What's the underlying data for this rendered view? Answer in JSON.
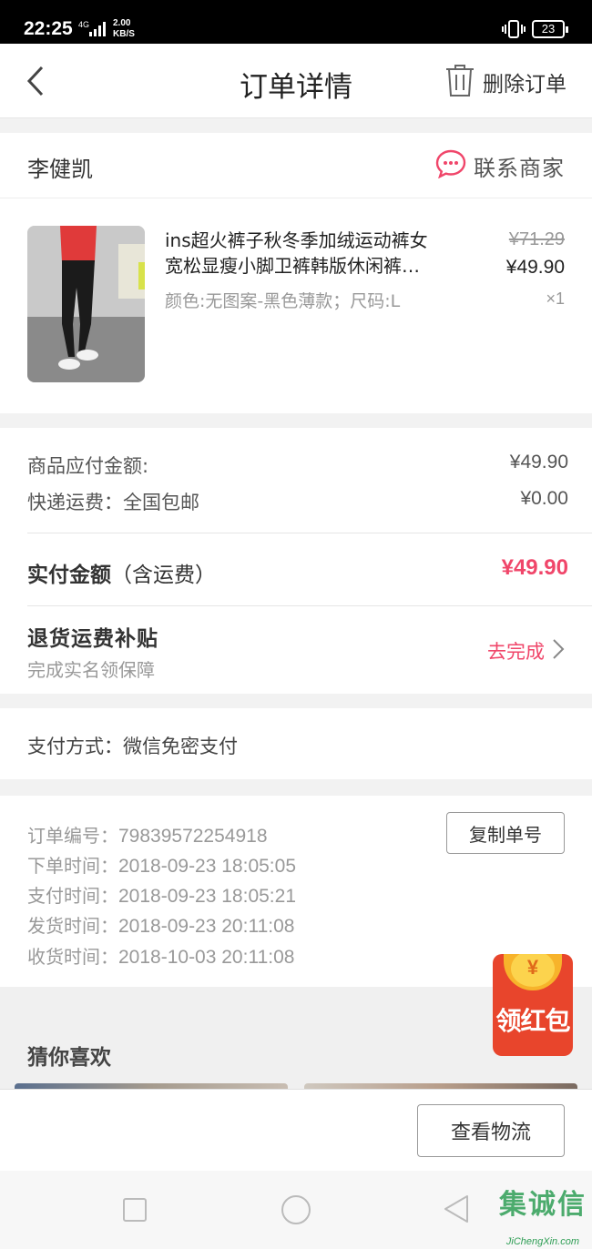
{
  "status_bar": {
    "time": "22:25",
    "network": "4G",
    "speed": "2.00",
    "speed_unit": "KB/S",
    "battery": "23"
  },
  "header": {
    "title": "订单详情",
    "delete_label": "删除订单"
  },
  "shop": {
    "name": "李健凯",
    "contact_label": "联系商家"
  },
  "product": {
    "title_line1": "ins超火裤子秋冬季加绒运动裤女",
    "title_line2": "宽松显瘦小脚卫裤韩版休闲裤…",
    "sku": "颜色:无图案-黑色薄款；尺码:L",
    "original_price": "¥71.29",
    "price": "¥49.90",
    "quantity": "×1"
  },
  "amounts": {
    "goods_label": "商品应付金额:",
    "goods_value": "¥49.90",
    "shipping_label": "快递运费：全国包邮",
    "shipping_value": "¥0.00",
    "paid_label": "实付金额",
    "paid_note": "（含运费）",
    "paid_value": "¥49.90"
  },
  "refund": {
    "title": "退货运费补贴",
    "subtitle": "完成实名领保障",
    "action": "去完成"
  },
  "payment": {
    "label": "支付方式：微信免密支付"
  },
  "order_info": {
    "number_label": "订单编号：",
    "number": "79839572254918",
    "placed_label": "下单时间：",
    "placed": "2018-09-23  18:05:05",
    "paid_label": "支付时间：",
    "paid": "2018-09-23  18:05:21",
    "shipped_label": "发货时间：",
    "shipped": "2018-09-23  20:11:08",
    "received_label": "收货时间：",
    "received": "2018-10-03  20:11:08",
    "copy_button": "复制单号"
  },
  "guess": {
    "title": "猜你喜欢"
  },
  "red_packet": {
    "symbol": "¥",
    "label": "领红包"
  },
  "bottom": {
    "logistics_button": "查看物流"
  },
  "watermark": {
    "text": "集诚信",
    "sub": "JiChengXin.com"
  },
  "colors": {
    "accent": "#f0466a",
    "red_packet": "#e8452c"
  },
  "icons": [
    "back-arrow-icon",
    "trash-icon",
    "chat-bubble-icon",
    "chevron-right-icon",
    "nav-square-icon",
    "nav-home-circle-icon",
    "nav-back-triangle-icon"
  ]
}
